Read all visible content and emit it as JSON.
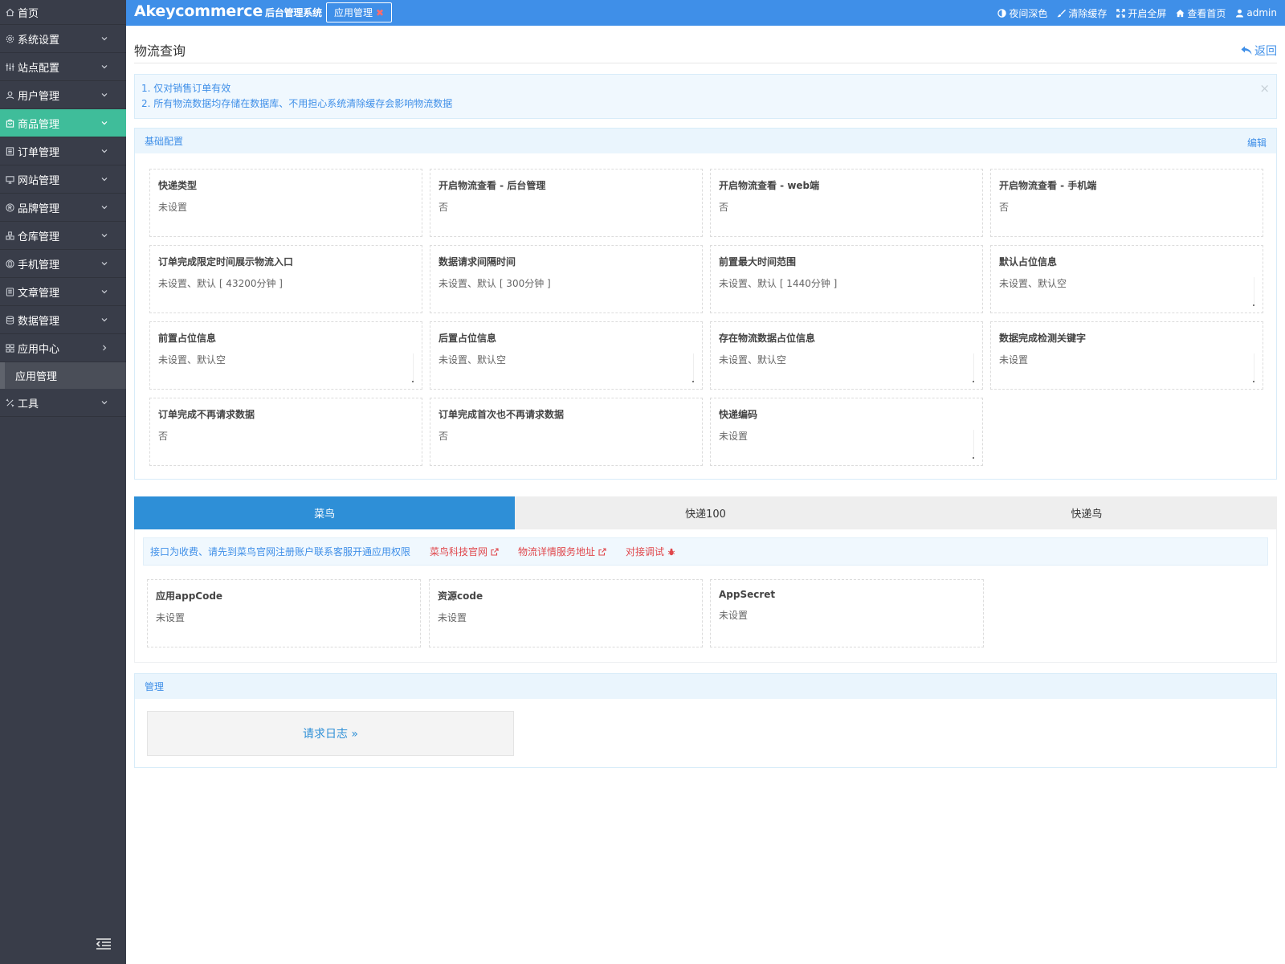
{
  "sidebar": {
    "items": [
      {
        "label": "首页",
        "icon": "home-icon"
      },
      {
        "label": "系统设置",
        "icon": "gear-icon"
      },
      {
        "label": "站点配置",
        "icon": "sliders-icon"
      },
      {
        "label": "用户管理",
        "icon": "user-icon"
      },
      {
        "label": "商品管理",
        "icon": "bag-icon"
      },
      {
        "label": "订单管理",
        "icon": "list-icon"
      },
      {
        "label": "网站管理",
        "icon": "monitor-icon"
      },
      {
        "label": "品牌管理",
        "icon": "registered-icon"
      },
      {
        "label": "仓库管理",
        "icon": "warehouse-icon"
      },
      {
        "label": "手机管理",
        "icon": "phone-icon"
      },
      {
        "label": "文章管理",
        "icon": "document-icon"
      },
      {
        "label": "数据管理",
        "icon": "database-icon"
      },
      {
        "label": "应用中心",
        "icon": "grid-icon"
      },
      {
        "label": "工具",
        "icon": "tools-icon"
      }
    ],
    "sub_item": "应用管理",
    "active_color": "#3fbd9a"
  },
  "header": {
    "brand": "Akeycommerce",
    "brand_sub": "后台管理系统",
    "tab_label": "应用管理",
    "tab_close": "✖",
    "menu": [
      "夜间深色",
      "清除缓存",
      "开启全屏",
      "查看首页",
      "admin"
    ],
    "color": "#3f8fe8"
  },
  "page": {
    "title": "物流查询",
    "back_label": "返回"
  },
  "notice": {
    "lines": [
      "1. 仅对销售订单有效",
      "2. 所有物流数据均存储在数据库、不用担心系统清除缓存会影响物流数据"
    ],
    "close": "×"
  },
  "basic": {
    "title": "基础配置",
    "edit": "编辑",
    "cards": [
      {
        "title": "快递类型",
        "value": "未设置"
      },
      {
        "title": "开启物流查看 - 后台管理",
        "value": "否"
      },
      {
        "title": "开启物流查看 - web端",
        "value": "否"
      },
      {
        "title": "开启物流查看 - 手机端",
        "value": "否"
      },
      {
        "title": "订单完成限定时间展示物流入口",
        "value": "未设置、默认 [ 43200分钟 ]"
      },
      {
        "title": "数据请求间隔时间",
        "value": "未设置、默认 [ 300分钟 ]"
      },
      {
        "title": "前置最大时间范围",
        "value": "未设置、默认 [ 1440分钟 ]"
      },
      {
        "title": "默认占位信息",
        "value": "未设置、默认空"
      },
      {
        "title": "前置占位信息",
        "value": "未设置、默认空"
      },
      {
        "title": "后置占位信息",
        "value": "未设置、默认空"
      },
      {
        "title": "存在物流数据占位信息",
        "value": "未设置、默认空"
      },
      {
        "title": "数据完成检测关键字",
        "value": "未设置"
      },
      {
        "title": "订单完成不再请求数据",
        "value": "否"
      },
      {
        "title": "订单完成首次也不再请求数据",
        "value": "否"
      },
      {
        "title": "快递编码",
        "value": "未设置"
      }
    ]
  },
  "tabs": {
    "items": [
      "菜鸟",
      "快递100",
      "快递鸟"
    ],
    "active": "菜鸟"
  },
  "cainiao": {
    "info": "接口为收费、请先到菜鸟官网注册账户联系客服开通应用权限",
    "links": [
      "菜鸟科技官网",
      "物流详情服务地址",
      "对接调试"
    ],
    "cards": [
      {
        "title": "应用appCode",
        "value": "未设置"
      },
      {
        "title": "资源code",
        "value": "未设置"
      },
      {
        "title": "AppSecret",
        "value": "未设置"
      }
    ]
  },
  "manage": {
    "title": "管理",
    "button": "请求日志 »"
  }
}
